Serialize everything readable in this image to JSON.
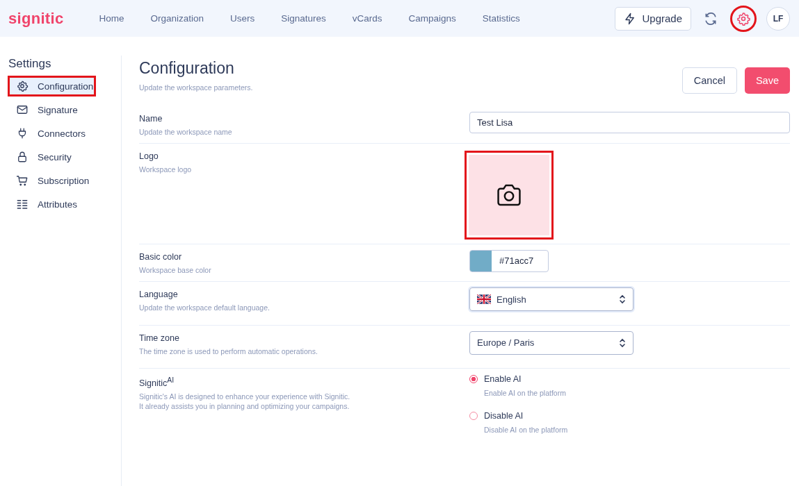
{
  "topbar": {
    "logo": "signitic",
    "nav": [
      "Home",
      "Organization",
      "Users",
      "Signatures",
      "vCards",
      "Campaigns",
      "Statistics"
    ],
    "upgrade": "Upgrade",
    "avatar": "LF"
  },
  "sidebar": {
    "title": "Settings",
    "items": [
      {
        "label": "Configuration",
        "selected": true
      },
      {
        "label": "Signature",
        "selected": false
      },
      {
        "label": "Connectors",
        "selected": false
      },
      {
        "label": "Security",
        "selected": false
      },
      {
        "label": "Subscription",
        "selected": false
      },
      {
        "label": "Attributes",
        "selected": false
      }
    ]
  },
  "page": {
    "title": "Configuration",
    "subtitle": "Update the workspace parameters.",
    "cancel": "Cancel",
    "save": "Save"
  },
  "rows": [
    {
      "kind": "text",
      "label": "Name",
      "hint": "Update the workspace name",
      "value": "Test Lisa"
    },
    {
      "kind": "logo",
      "label": "Logo",
      "hint": "Workspace logo"
    },
    {
      "kind": "color",
      "label": "Basic color",
      "hint": "Workspace base color",
      "value": "#71acc7"
    },
    {
      "kind": "flag-select",
      "label": "Language",
      "hint": "Update the workspace default language.",
      "value": "English"
    },
    {
      "kind": "select",
      "label": "Time zone",
      "hint": "The time zone is used to perform automatic operations.",
      "value": "Europe / Paris"
    },
    {
      "kind": "radio",
      "label": "Signitic$^{AI}$",
      "hint": "Signitic's AI is designed to enhance your experience with Signitic.\nIt already assists you in planning and optimizing your campaigns.",
      "options": [
        {
          "label": "Enable AI",
          "hint": "Enable AI on the platform",
          "selected": true
        },
        {
          "label": "Disable AI",
          "hint": "Disable AI on the platform",
          "selected": false
        }
      ]
    }
  ]
}
